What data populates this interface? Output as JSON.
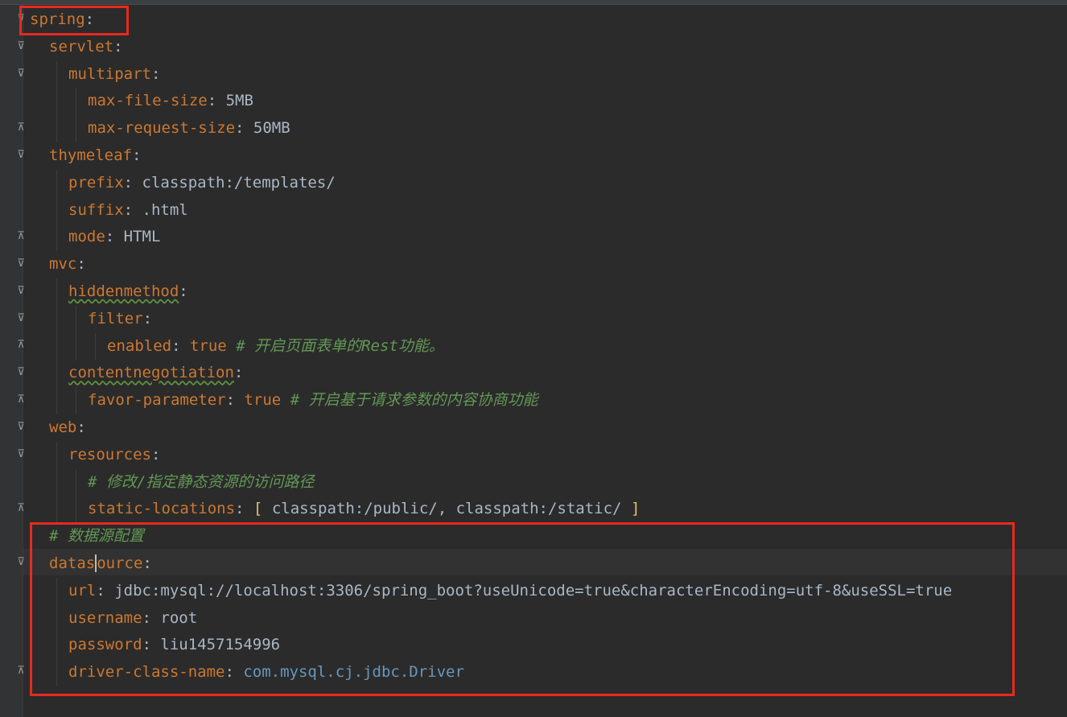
{
  "editor": {
    "spring_key": "spring",
    "servlet_key": "servlet",
    "multipart_key": "multipart",
    "max_file_size_key": "max-file-size",
    "max_file_size_val": "5MB",
    "max_request_size_key": "max-request-size",
    "max_request_size_val": "50MB",
    "thymeleaf_key": "thymeleaf",
    "prefix_key": "prefix",
    "prefix_val": "classpath:/templates/",
    "suffix_key": "suffix",
    "suffix_val": ".html",
    "mode_key": "mode",
    "mode_val": "HTML",
    "mvc_key": "mvc",
    "hiddenmethod_key": "hiddenmethod",
    "filter_key": "filter",
    "enabled_key": "enabled",
    "enabled_val": "true",
    "enabled_comment": "# 开启页面表单的Rest功能。",
    "contentnegotiation_key": "contentnegotiation",
    "favor_parameter_key": "favor-parameter",
    "favor_parameter_val": "true",
    "favor_parameter_comment": "# 开启基于请求参数的内容协商功能",
    "web_key": "web",
    "resources_key": "resources",
    "resources_comment": "# 修改/指定静态资源的访问路径",
    "static_locations_key": "static-locations",
    "static_locations_open": "[",
    "static_locations_val": " classpath:/public/, classpath:/static/ ",
    "static_locations_close": "]",
    "datasource_comment": "# 数据源配置",
    "datasource_key_a": "datas",
    "datasource_key_b": "ource",
    "url_key": "url",
    "url_val": "jdbc:mysql://localhost:3306/spring_boot?useUnicode=true&characterEncoding=utf-8&useSSL=true",
    "username_key": "username",
    "username_val": "root",
    "password_key": "password",
    "password_val": "liu1457154996",
    "driver_key": "driver-class-name",
    "driver_val": "com.mysql.cj.jdbc.Driver"
  },
  "colors": {
    "background": "#2b2b2b",
    "key": "#cc7832",
    "value": "#a9b7c6",
    "comment": "#629755",
    "class_ref": "#6897bb",
    "highlight_box": "#e8291f"
  },
  "icons": [
    "fold-open-icon",
    "fold-close-icon"
  ]
}
